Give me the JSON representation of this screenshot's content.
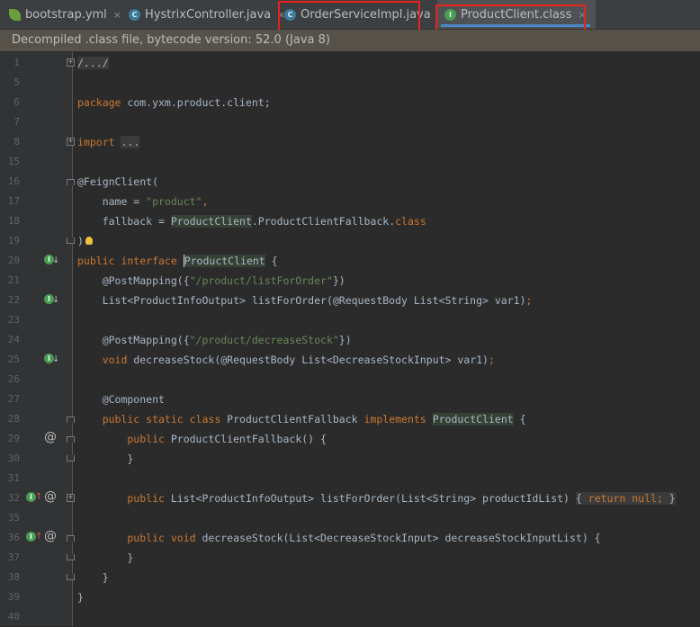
{
  "tabs": [
    {
      "label": "bootstrap.yml",
      "close": "×",
      "icon": "yml-leaf-icon"
    },
    {
      "label": "HystrixController.java",
      "close": "×",
      "icon": "java-class-icon"
    },
    {
      "label": "OrderServiceImpl.java",
      "close": "×",
      "icon": "java-class-icon"
    },
    {
      "label": "ProductClient.class",
      "close": "×",
      "icon": "interface-icon"
    }
  ],
  "infobar": {
    "text": "Decompiled .class file, bytecode version: 52.0 (Java 8)"
  },
  "code": {
    "line_numbers": [
      "1",
      "5",
      "6",
      "7",
      "8",
      "15",
      "16",
      "17",
      "18",
      "19",
      "20",
      "21",
      "22",
      "23",
      "24",
      "25",
      "26",
      "27",
      "28",
      "29",
      "30",
      "31",
      "32",
      "35",
      "36",
      "37",
      "38",
      "39",
      "40"
    ],
    "l1_fold": "/.../",
    "l6_kw": "package",
    "l6_rest": " com.yxm.product.client;",
    "l8_kw": "import",
    "l8_rest": "...",
    "l16": "@FeignClient(",
    "l17_a": "    name = ",
    "l17_str": "\"product\"",
    "l17_b": ",",
    "l18_a": "    fallback = ",
    "l18_cls": "ProductClient",
    "l18_b": ".ProductClientFallback.",
    "l18_kw": "class",
    "l19": ")",
    "l20_kw": "public interface ",
    "l20_name": "ProductClient",
    "l20_b": " {",
    "l21_a": "    @PostMapping({",
    "l21_str": "\"/product/listForOrder\"",
    "l21_b": "})",
    "l22_a": "    List<ProductInfoOutput> listForOrder(@RequestBody List<String> var1)",
    "l22_b": ";",
    "l24_a": "    @PostMapping({",
    "l24_str": "\"/product/decreaseStock\"",
    "l24_b": "})",
    "l25_kw": "    void",
    "l25_a": " decreaseStock(@RequestBody List<DecreaseStockInput> var1)",
    "l25_b": ";",
    "l27": "    @Component",
    "l28_kw": "    public static class",
    "l28_a": " ProductClientFallback ",
    "l28_kw2": "implements",
    "l28_sp": " ",
    "l28_cls": "ProductClient",
    "l28_b": " {",
    "l29_kw": "        public",
    "l29_a": " ProductClientFallback() {",
    "l30": "        }",
    "l32_kw": "        public",
    "l32_a": " List<ProductInfoOutput> listForOrder(List<String> productIdList) ",
    "l32_b1": "{ ",
    "l32_kw2": "return null",
    "l32_semi": ";",
    "l32_b2": " }",
    "l36_kw": "        public void",
    "l36_a": " decreaseStock(List<DecreaseStockInput> decreaseStockInputList) {",
    "l37": "        }",
    "l38": "    }",
    "l39": "}"
  },
  "colors": {
    "keyword": "#cc7832",
    "string": "#6a8759",
    "annotation": "#bbb529",
    "text": "#a9b7c6",
    "highlight_box": "#e8221b"
  }
}
